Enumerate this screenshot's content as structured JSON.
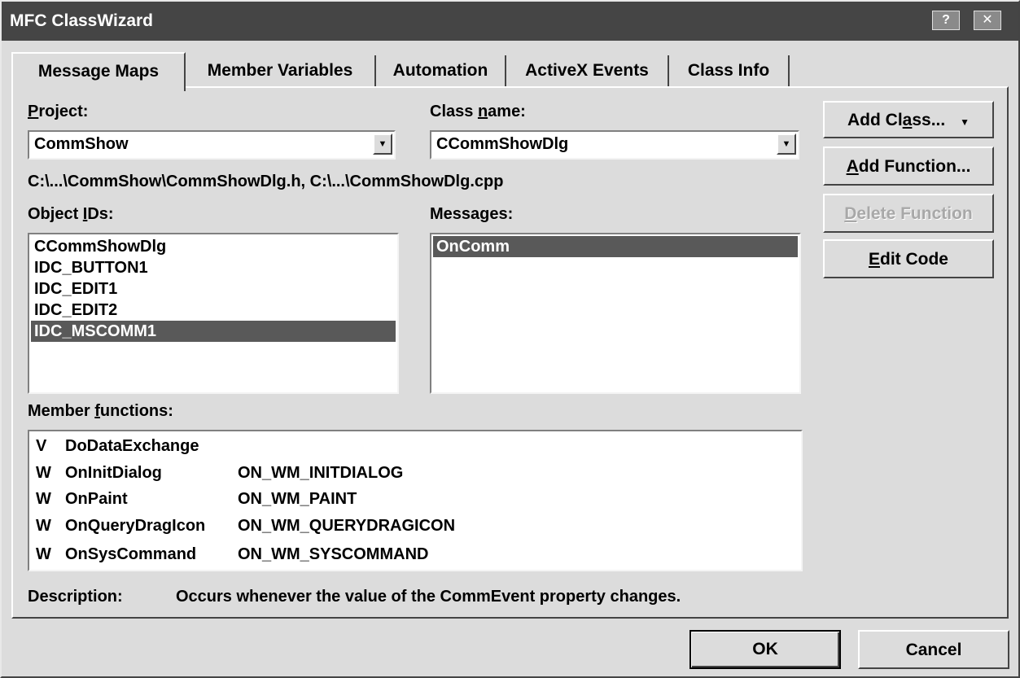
{
  "window": {
    "title": "MFC ClassWizard",
    "help_glyph": "?",
    "close_glyph": "✕"
  },
  "tabs": [
    {
      "label": "Message Maps",
      "active": true
    },
    {
      "label": "Member Variables",
      "active": false
    },
    {
      "label": "Automation",
      "active": false
    },
    {
      "label": "ActiveX Events",
      "active": false
    },
    {
      "label": "Class Info",
      "active": false
    }
  ],
  "project": {
    "label_pre": "",
    "label_u": "P",
    "label_post": "roject:",
    "value": "CommShow"
  },
  "class_name": {
    "label_pre": "Class ",
    "label_u": "n",
    "label_post": "ame:",
    "value": "CCommShowDlg"
  },
  "file_path": "C:\\...\\CommShow\\CommShowDlg.h, C:\\...\\CommShowDlg.cpp",
  "object_ids": {
    "label_pre": "Object ",
    "label_u": "I",
    "label_post": "Ds:",
    "items": [
      "CCommShowDlg",
      "IDC_BUTTON1",
      "IDC_EDIT1",
      "IDC_EDIT2",
      "IDC_MSCOMM1"
    ],
    "selected_index": 4
  },
  "messages": {
    "label_pre": "Messages:",
    "label_u": "",
    "label_post": "",
    "items": [
      "OnComm"
    ],
    "selected_index": 0
  },
  "member_functions": {
    "label_pre": "Member ",
    "label_u": "f",
    "label_post": "unctions:",
    "rows": [
      {
        "kind": "V",
        "name": "DoDataExchange",
        "macro": ""
      },
      {
        "kind": "W",
        "name": "OnInitDialog",
        "macro": "ON_WM_INITDIALOG"
      },
      {
        "kind": "W",
        "name": "OnPaint",
        "macro": "ON_WM_PAINT"
      },
      {
        "kind": "W",
        "name": "OnQueryDragIcon",
        "macro": "ON_WM_QUERYDRAGICON"
      },
      {
        "kind": "W",
        "name": "OnSysCommand",
        "macro": "ON_WM_SYSCOMMAND"
      }
    ]
  },
  "description": {
    "label": "Description:",
    "text": "Occurs whenever the value of the CommEvent property changes."
  },
  "buttons": {
    "add_class": {
      "pre": "Add Cl",
      "u": "a",
      "post": "ss...",
      "arrow": "▼"
    },
    "add_function": {
      "pre": "",
      "u": "A",
      "post": "dd Function..."
    },
    "delete_function": {
      "pre": "",
      "u": "D",
      "post": "elete Function",
      "enabled": false
    },
    "edit_code": {
      "pre": "",
      "u": "E",
      "post": "dit Code"
    },
    "ok": "OK",
    "cancel": "Cancel"
  },
  "icons": {
    "dropdown": "down-triangle",
    "help": "question-mark",
    "close": "x-mark"
  }
}
